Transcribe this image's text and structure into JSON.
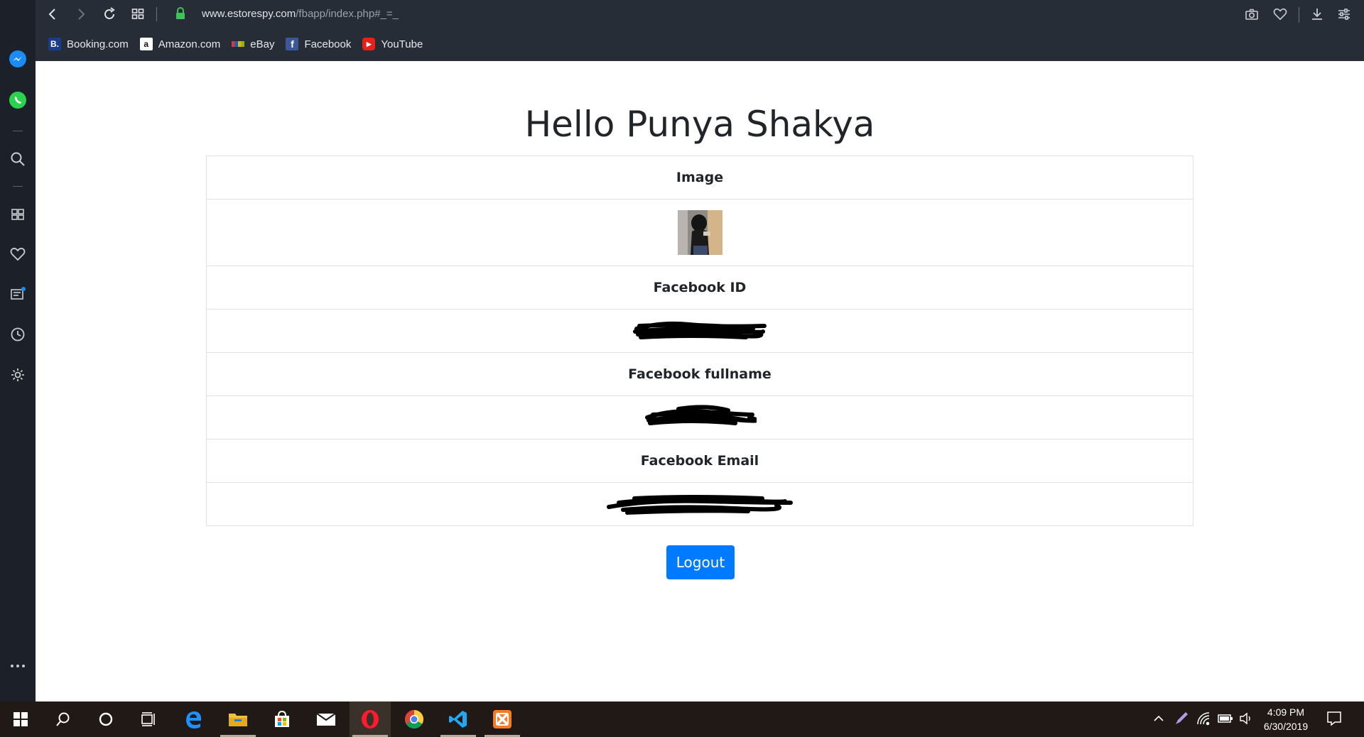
{
  "browser": {
    "url_host": "www.estorespy.com",
    "url_path": "/fbapp/index.php#_=_",
    "bookmarks": [
      {
        "label": "Booking.com",
        "icon": "booking-icon",
        "icon_text": "B.",
        "icon_bg": "#1a3c8e"
      },
      {
        "label": "Amazon.com",
        "icon": "amazon-icon",
        "icon_text": "a",
        "icon_bg": "#ffffff"
      },
      {
        "label": "eBay",
        "icon": "ebay-icon",
        "icon_text": "",
        "icon_bg": "#e53238"
      },
      {
        "label": "Facebook",
        "icon": "facebook-icon",
        "icon_text": "f",
        "icon_bg": "#3b5998"
      },
      {
        "label": "YouTube",
        "icon": "youtube-icon",
        "icon_text": "▶",
        "icon_bg": "#e62117"
      }
    ]
  },
  "page": {
    "greeting": "Hello Punya Shakya",
    "rows": [
      {
        "label": "Image"
      },
      {
        "label": "Facebook ID"
      },
      {
        "label": "Facebook fullname"
      },
      {
        "label": "Facebook Email"
      }
    ],
    "logout_label": "Logout",
    "accent": "#007bff"
  },
  "taskbar": {
    "time": "4:09 PM",
    "date": "6/30/2019"
  }
}
